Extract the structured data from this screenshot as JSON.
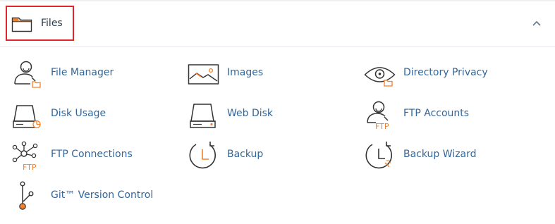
{
  "section": {
    "title": "Files",
    "collapse_icon": "chevron-up-icon"
  },
  "colors": {
    "accent": "#f57f29",
    "link": "#336699",
    "highlight_border": "#e0262b",
    "icon_stroke": "#333333"
  },
  "items": [
    {
      "label": "File Manager",
      "icon": "file-manager-icon"
    },
    {
      "label": "Images",
      "icon": "images-icon"
    },
    {
      "label": "Directory Privacy",
      "icon": "directory-privacy-icon"
    },
    {
      "label": "Disk Usage",
      "icon": "disk-usage-icon"
    },
    {
      "label": "Web Disk",
      "icon": "web-disk-icon"
    },
    {
      "label": "FTP Accounts",
      "icon": "ftp-accounts-icon"
    },
    {
      "label": "FTP Connections",
      "icon": "ftp-connections-icon"
    },
    {
      "label": "Backup",
      "icon": "backup-icon"
    },
    {
      "label": "Backup Wizard",
      "icon": "backup-wizard-icon"
    },
    {
      "label": "Git™ Version Control",
      "icon": "git-version-control-icon"
    }
  ],
  "icon_text": {
    "ftp": "FTP"
  }
}
